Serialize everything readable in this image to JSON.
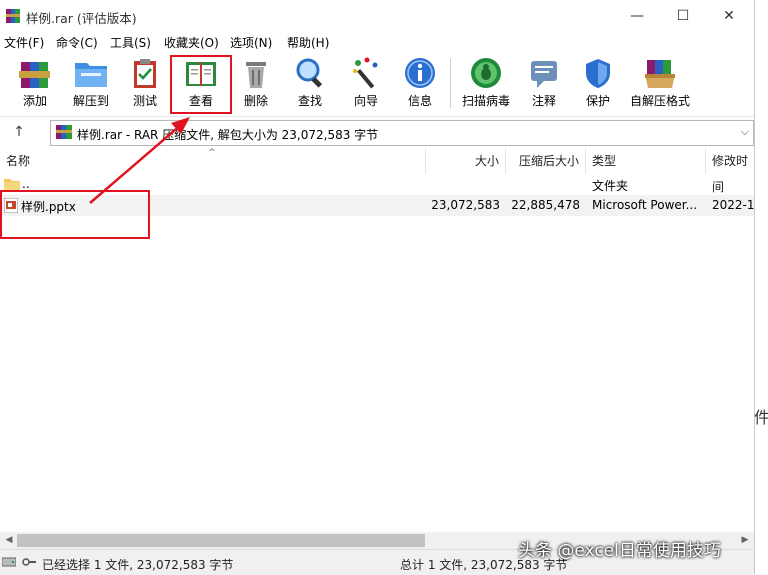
{
  "window": {
    "title": "样例.rar (评估版本)",
    "controls": {
      "minimize": "—",
      "maximize": "☐",
      "close": "✕"
    }
  },
  "menu": [
    {
      "label": "文件(F)"
    },
    {
      "label": "命令(C)"
    },
    {
      "label": "工具(S)"
    },
    {
      "label": "收藏夹(O)"
    },
    {
      "label": "选项(N)"
    },
    {
      "label": "帮助(H)"
    }
  ],
  "toolbar": [
    {
      "label": "添加",
      "icon": "add-books-icon"
    },
    {
      "label": "解压到",
      "icon": "extract-folder-icon"
    },
    {
      "label": "测试",
      "icon": "test-clipboard-icon"
    },
    {
      "label": "查看",
      "icon": "view-book-icon"
    },
    {
      "label": "删除",
      "icon": "trash-icon"
    },
    {
      "label": "查找",
      "icon": "magnifier-icon"
    },
    {
      "label": "向导",
      "icon": "wizard-wand-icon"
    },
    {
      "label": "信息",
      "icon": "info-icon"
    },
    {
      "label": "扫描病毒",
      "icon": "virus-scan-icon"
    },
    {
      "label": "注释",
      "icon": "comment-icon"
    },
    {
      "label": "保护",
      "icon": "shield-icon"
    },
    {
      "label": "自解压格式",
      "icon": "sfx-box-icon"
    }
  ],
  "address": {
    "up": "↑",
    "text": "样例.rar - RAR 压缩文件, 解包大小为 23,072,583 字节",
    "dropdown": "⌵"
  },
  "columns": [
    {
      "label": "名称"
    },
    {
      "label": "大小"
    },
    {
      "label": "压缩后大小"
    },
    {
      "label": "类型"
    },
    {
      "label": "修改时间"
    }
  ],
  "sort_indicator": "^",
  "rows": [
    {
      "name": "..",
      "size": "",
      "packed": "",
      "type": "文件夹",
      "modified": ""
    },
    {
      "name": "样例.pptx",
      "size": "23,072,583",
      "packed": "22,885,478",
      "type": "Microsoft Power...",
      "modified": "2022-1"
    }
  ],
  "status": {
    "left": "已经选择 1 文件, 23,072,583 字节",
    "right": "总计 1 文件, 23,072,583 字节"
  },
  "watermark": "头条 @excel日常使用技巧",
  "side_char": "件",
  "colors": {
    "annotation": "#e0141e",
    "selected_row": "#f2f2f2"
  }
}
